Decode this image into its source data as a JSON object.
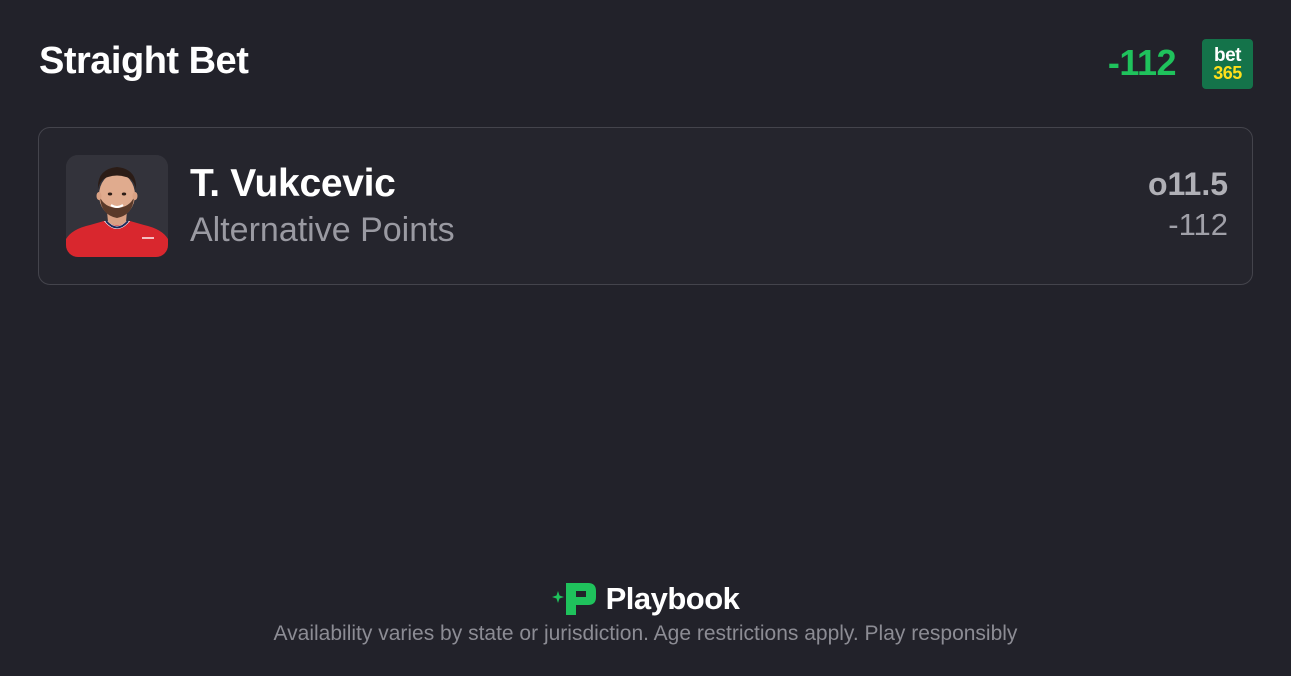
{
  "header": {
    "title": "Straight Bet",
    "odds": "-112",
    "sportsbook_logo": {
      "line1": "bet",
      "line2": "365",
      "bg_color": "#14734a",
      "accent_color": "#ffdf1b"
    }
  },
  "bet": {
    "player_name": "T. Vukcevic",
    "market": "Alternative Points",
    "line": "o11.5",
    "odds": "-112"
  },
  "footer": {
    "brand": "Playbook",
    "disclaimer": "Availability varies by state or jurisdiction. Age restrictions apply. Play responsibly"
  },
  "colors": {
    "background": "#22222a",
    "odds_green": "#1fc25c",
    "brand_green": "#1fc25c",
    "jersey_red": "#d9272e"
  }
}
